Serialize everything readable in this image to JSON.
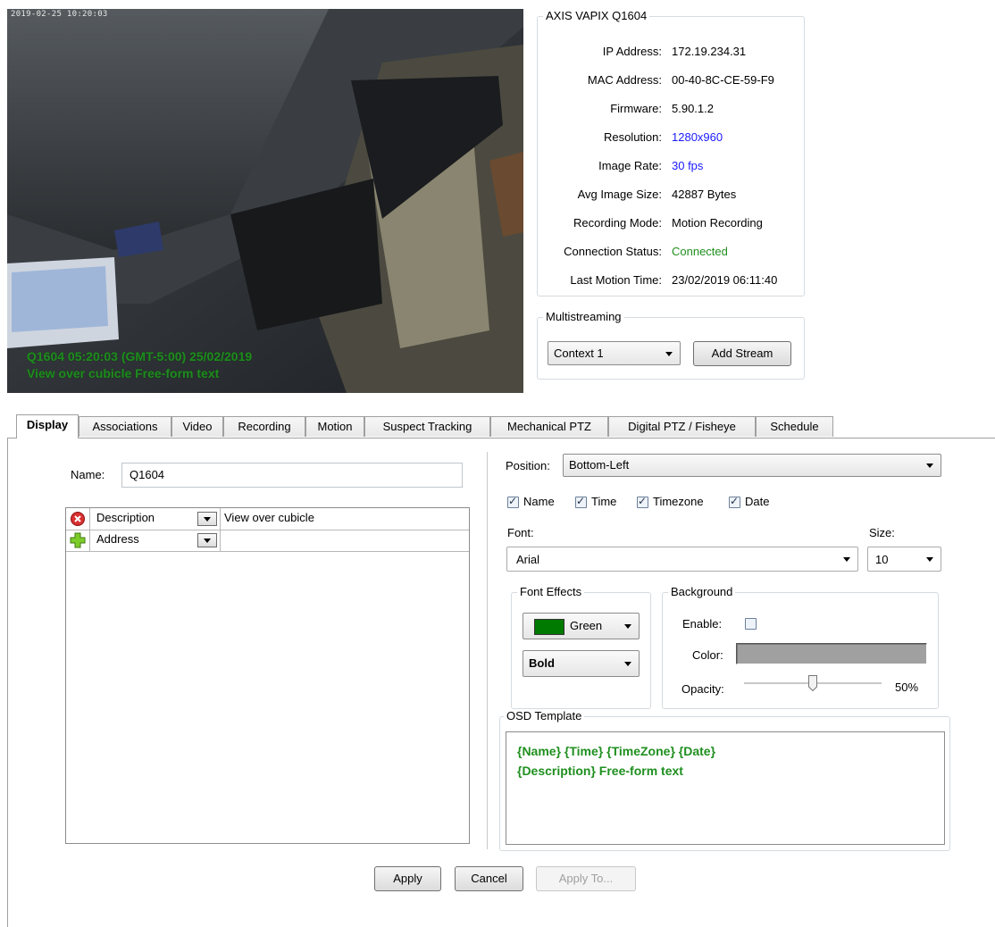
{
  "video": {
    "timestamp": "2019-02-25 10:20:03",
    "osd_line1": "Q1604 05:20:03 (GMT-5:00) 25/02/2019",
    "osd_line2": "View over cubicle Free-form text"
  },
  "camera_info": {
    "title": "AXIS VAPIX Q1604",
    "rows": [
      {
        "label": "IP Address:",
        "value": "172.19.234.31",
        "color": "#000000"
      },
      {
        "label": "MAC Address:",
        "value": "00-40-8C-CE-59-F9",
        "color": "#000000"
      },
      {
        "label": "Firmware:",
        "value": "5.90.1.2",
        "color": "#000000"
      },
      {
        "label": "Resolution:",
        "value": "1280x960",
        "color": "#1a1aff"
      },
      {
        "label": "Image Rate:",
        "value": "30 fps",
        "color": "#1a1aff"
      },
      {
        "label": "Avg Image Size:",
        "value": "42887 Bytes",
        "color": "#000000"
      },
      {
        "label": "Recording Mode:",
        "value": "Motion Recording",
        "color": "#000000"
      },
      {
        "label": "Connection Status:",
        "value": "Connected",
        "color": "#1f8f1f"
      },
      {
        "label": "Last Motion Time:",
        "value": "23/02/2019 06:11:40",
        "color": "#000000"
      }
    ]
  },
  "multistreaming": {
    "title": "Multistreaming",
    "context_value": "Context 1",
    "add_stream_label": "Add Stream"
  },
  "tabs": [
    {
      "label": "Display",
      "active": true
    },
    {
      "label": "Associations",
      "active": false
    },
    {
      "label": "Video",
      "active": false
    },
    {
      "label": "Recording",
      "active": false
    },
    {
      "label": "Motion",
      "active": false
    },
    {
      "label": "Suspect Tracking",
      "active": false
    },
    {
      "label": "Mechanical PTZ",
      "active": false
    },
    {
      "label": "Digital PTZ / Fisheye",
      "active": false
    },
    {
      "label": "Schedule",
      "active": false
    }
  ],
  "display": {
    "name_label": "Name:",
    "name_value": "Q1604",
    "attributes": [
      {
        "icon": "remove-icon",
        "field": "Description",
        "value": "View over cubicle"
      },
      {
        "icon": "add-icon",
        "field": "Address",
        "value": ""
      }
    ],
    "position_label": "Position:",
    "position_value": "Bottom-Left",
    "checkboxes": [
      {
        "label": "Name",
        "checked": true
      },
      {
        "label": "Time",
        "checked": true
      },
      {
        "label": "Timezone",
        "checked": true
      },
      {
        "label": "Date",
        "checked": true
      }
    ],
    "font_label": "Font:",
    "font_value": "Arial",
    "size_label": "Size:",
    "size_value": "10",
    "font_effects": {
      "title": "Font Effects",
      "color_name": "Green",
      "color_hex": "#007a00",
      "style_value": "Bold"
    },
    "background": {
      "title": "Background",
      "enable_label": "Enable:",
      "enabled": false,
      "color_label": "Color:",
      "color_hex": "#a0a0a0",
      "opacity_label": "Opacity:",
      "opacity_value": "50%",
      "opacity_fraction": 0.5
    },
    "osd_template": {
      "title": "OSD Template",
      "line1": "{Name} {Time} {TimeZone} {Date}",
      "line2": "{Description} Free-form text",
      "color": "#1f8f1f"
    }
  },
  "footer": {
    "apply_label": "Apply",
    "cancel_label": "Cancel",
    "apply_to_label": "Apply To..."
  }
}
